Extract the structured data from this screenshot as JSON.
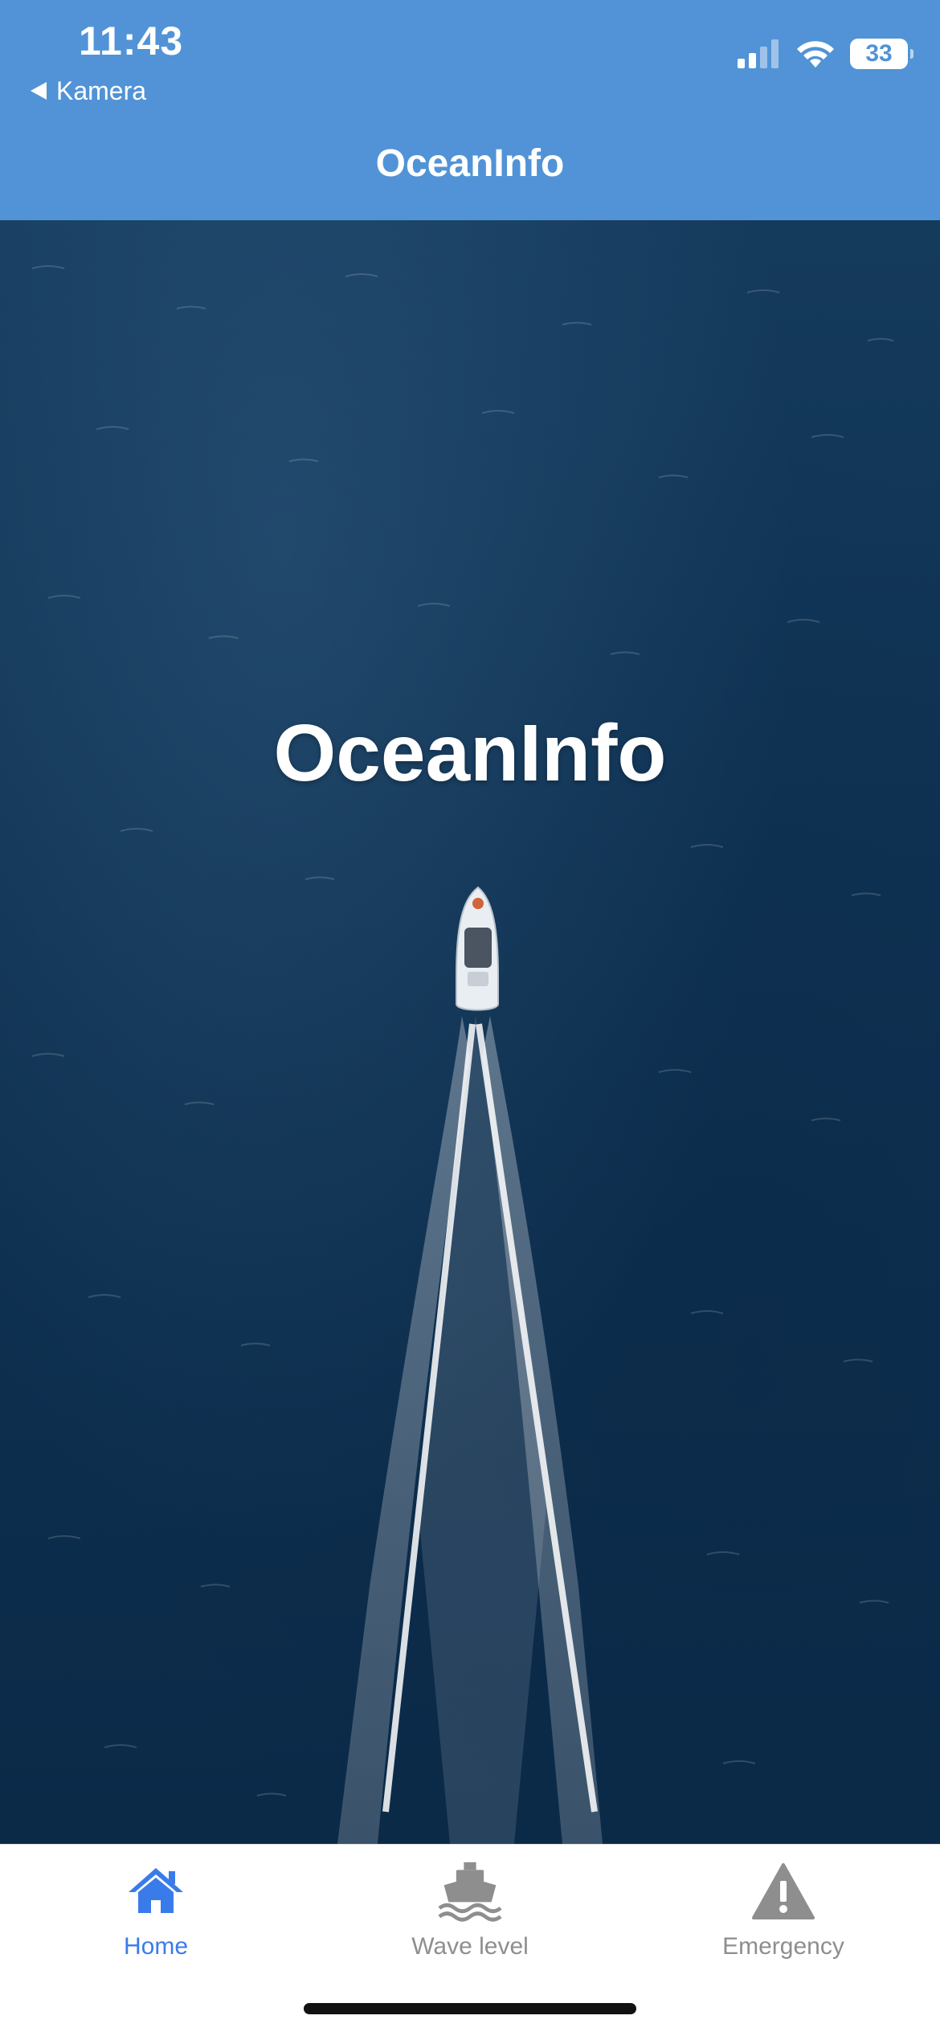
{
  "status_bar": {
    "time": "11:43",
    "back_label": "Kamera",
    "battery": "33"
  },
  "nav": {
    "title": "OceanInfo"
  },
  "hero": {
    "title": "OceanInfo"
  },
  "tabs": [
    {
      "label": "Home",
      "icon": "home-icon",
      "active": true
    },
    {
      "label": "Wave level",
      "icon": "ship-icon",
      "active": false
    },
    {
      "label": "Emergency",
      "icon": "warning-icon",
      "active": false
    }
  ],
  "colors": {
    "header": "#5193d6",
    "active_tab": "#3a7bea",
    "inactive_tab": "#8e8e8e",
    "ocean": "#0f3253"
  }
}
